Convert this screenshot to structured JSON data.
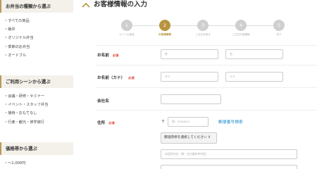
{
  "sidebar": {
    "sections": [
      {
        "heading": "お弁当の種類から選ぶ",
        "items": [
          "・すべての商品",
          "・飯弁",
          "・オリジナル弁当",
          "・季節のお弁当",
          "・オードブル"
        ]
      },
      {
        "heading": "ご利用シーンから選ぶ",
        "items": [
          "・会議・研修・セミナー",
          "・イベント・スタッフ弁当",
          "・接待・おもてなし",
          "・行楽・観光・修学旅行"
        ]
      },
      {
        "heading": "価格帯から選ぶ",
        "items": [
          "・〜1,000円"
        ]
      }
    ]
  },
  "main": {
    "title": "お客様情報の入力",
    "steps": [
      {
        "num": "1",
        "label": "カートの商品",
        "active": false
      },
      {
        "num": "2",
        "label": "お客様情報",
        "active": true
      },
      {
        "num": "3",
        "label": "ご注文手続き",
        "active": false
      },
      {
        "num": "4",
        "label": "ご注文内容確認",
        "active": false
      },
      {
        "num": "5",
        "label": "完了",
        "active": false
      }
    ],
    "form": {
      "required_label": "必須",
      "name_label": "お名前",
      "last_name_placeholder": "姓",
      "first_name_placeholder": "名",
      "kana_label": "お名前（カナ）",
      "last_kana_placeholder": "セイ",
      "first_kana_placeholder": "メイ",
      "company_label": "会社名",
      "address_label": "住所",
      "postal_mark": "〒",
      "postal_placeholder": "例：4500015",
      "postal_search_label": "郵便番号検索",
      "prefecture_select": "都道府県を選択してください ⇕",
      "city_placeholder": "市区町村名（例：名古屋市中村区）"
    }
  },
  "colors": {
    "accent": "#b8953e",
    "required": "#e0453b",
    "link": "#2a8fd0",
    "sidebar_border": "#b79a5a"
  }
}
